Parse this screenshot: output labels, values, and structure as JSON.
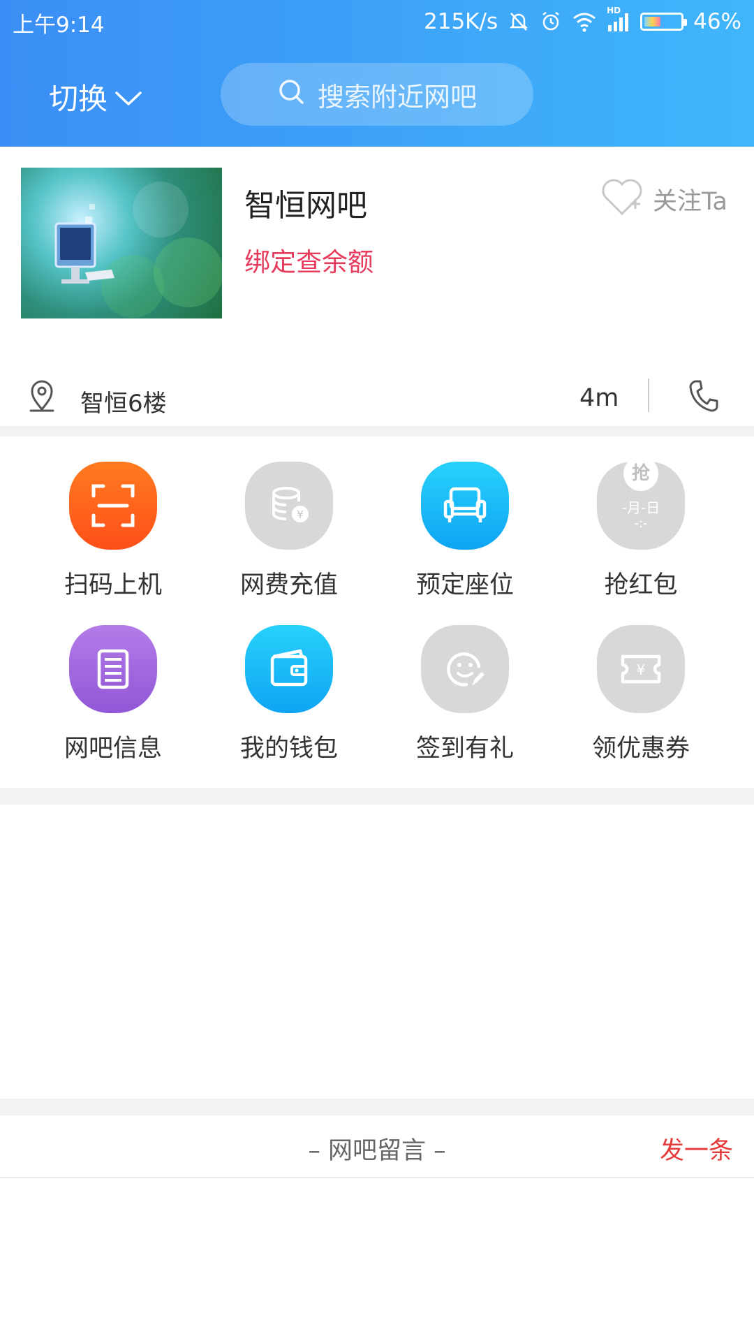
{
  "status_bar": {
    "time": "上午9:14",
    "speed": "215K/s",
    "network": "HD",
    "battery": "46%",
    "battery_level": 0.46
  },
  "header": {
    "switch_label": "切换",
    "search_placeholder": "搜索附近网吧"
  },
  "shop": {
    "name": "智恒网吧",
    "bind_label": "绑定查余额",
    "follow_label": "关注Ta",
    "address": "智恒6楼",
    "distance": "4m"
  },
  "features": [
    {
      "label": "扫码上机",
      "icon": "scan-icon",
      "color": "#ff6a1f"
    },
    {
      "label": "网费充值",
      "icon": "coin-stack-icon",
      "color": "#d6d6d6"
    },
    {
      "label": "预定座位",
      "icon": "seat-icon",
      "color": "#17b3f5"
    },
    {
      "label": "抢红包",
      "icon": "red-packet-icon",
      "color": "#d6d6d6",
      "badge": "抢",
      "date_line": "-月-日",
      "time_line": "-:-"
    },
    {
      "label": "网吧信息",
      "icon": "document-list-icon",
      "color": "#a56ee0"
    },
    {
      "label": "我的钱包",
      "icon": "wallet-icon",
      "color": "#17b3f5"
    },
    {
      "label": "签到有礼",
      "icon": "smile-pen-icon",
      "color": "#d6d6d6"
    },
    {
      "label": "领优惠券",
      "icon": "coupon-icon",
      "color": "#d6d6d6"
    }
  ],
  "messages": {
    "title": "– 网吧留言 –",
    "post_label": "发一条"
  },
  "colors": {
    "header_start": "#3b8ef5",
    "header_end": "#3fb6fb",
    "accent_red": "#e83a5c"
  }
}
